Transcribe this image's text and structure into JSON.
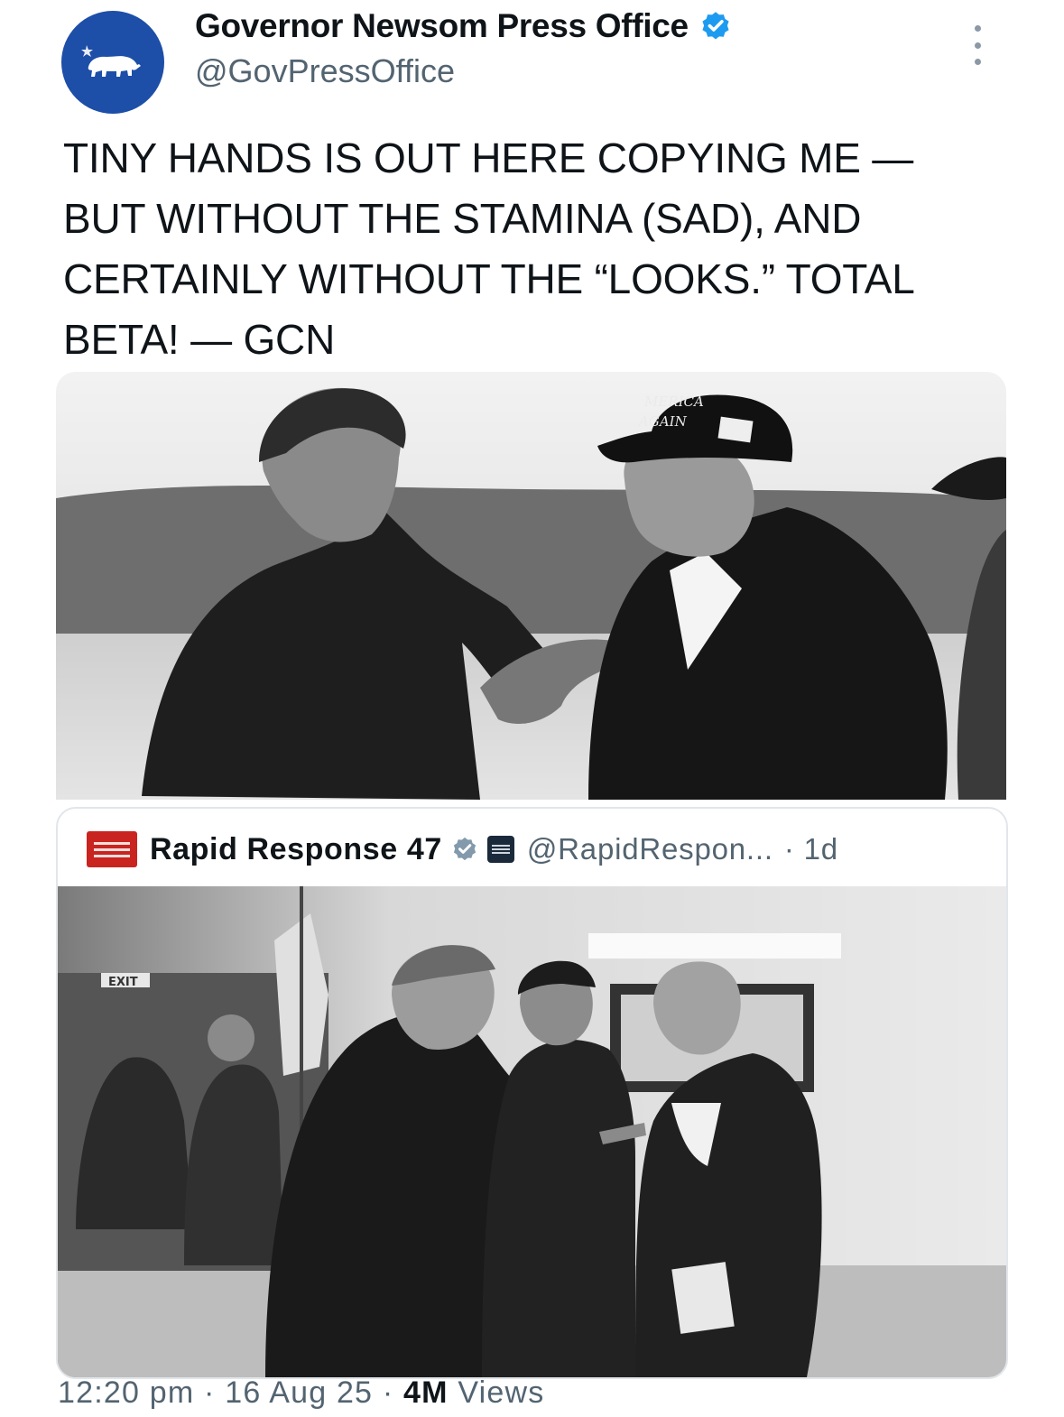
{
  "author": {
    "name": "Governor Newsom Press Office",
    "handle": "@GovPressOffice",
    "verified_icon": "verified-badge-icon",
    "avatar_icon": "california-bear-icon"
  },
  "tweet": {
    "text": "TINY HANDS IS OUT HERE COPYING ME —\nBUT WITHOUT THE STAMINA (SAD), AND\nCERTAINLY WITHOUT THE “LOOKS.” TOTAL\nBETA! — GCN"
  },
  "photo1": {
    "cap_text_line1": "MERICA",
    "cap_text_line2": "AGAIN"
  },
  "quote": {
    "name": "Rapid Response 47",
    "handle": "@RapidRespon...",
    "time": "· 1d",
    "verified_icon": "verified-badge-icon",
    "affiliate_icon": "affiliate-badge-icon"
  },
  "photo2": {
    "exit_sign": "EXIT"
  },
  "meta": {
    "time": "12:20 pm",
    "date": "16 Aug 25",
    "views_count": "4M",
    "views_label": "Views",
    "separator": "·"
  },
  "colors": {
    "avatar_bg": "#1d4ea8",
    "verified": "#1d9bf0",
    "secondary_text": "#536471",
    "rapid_response_red": "#c9241f"
  }
}
